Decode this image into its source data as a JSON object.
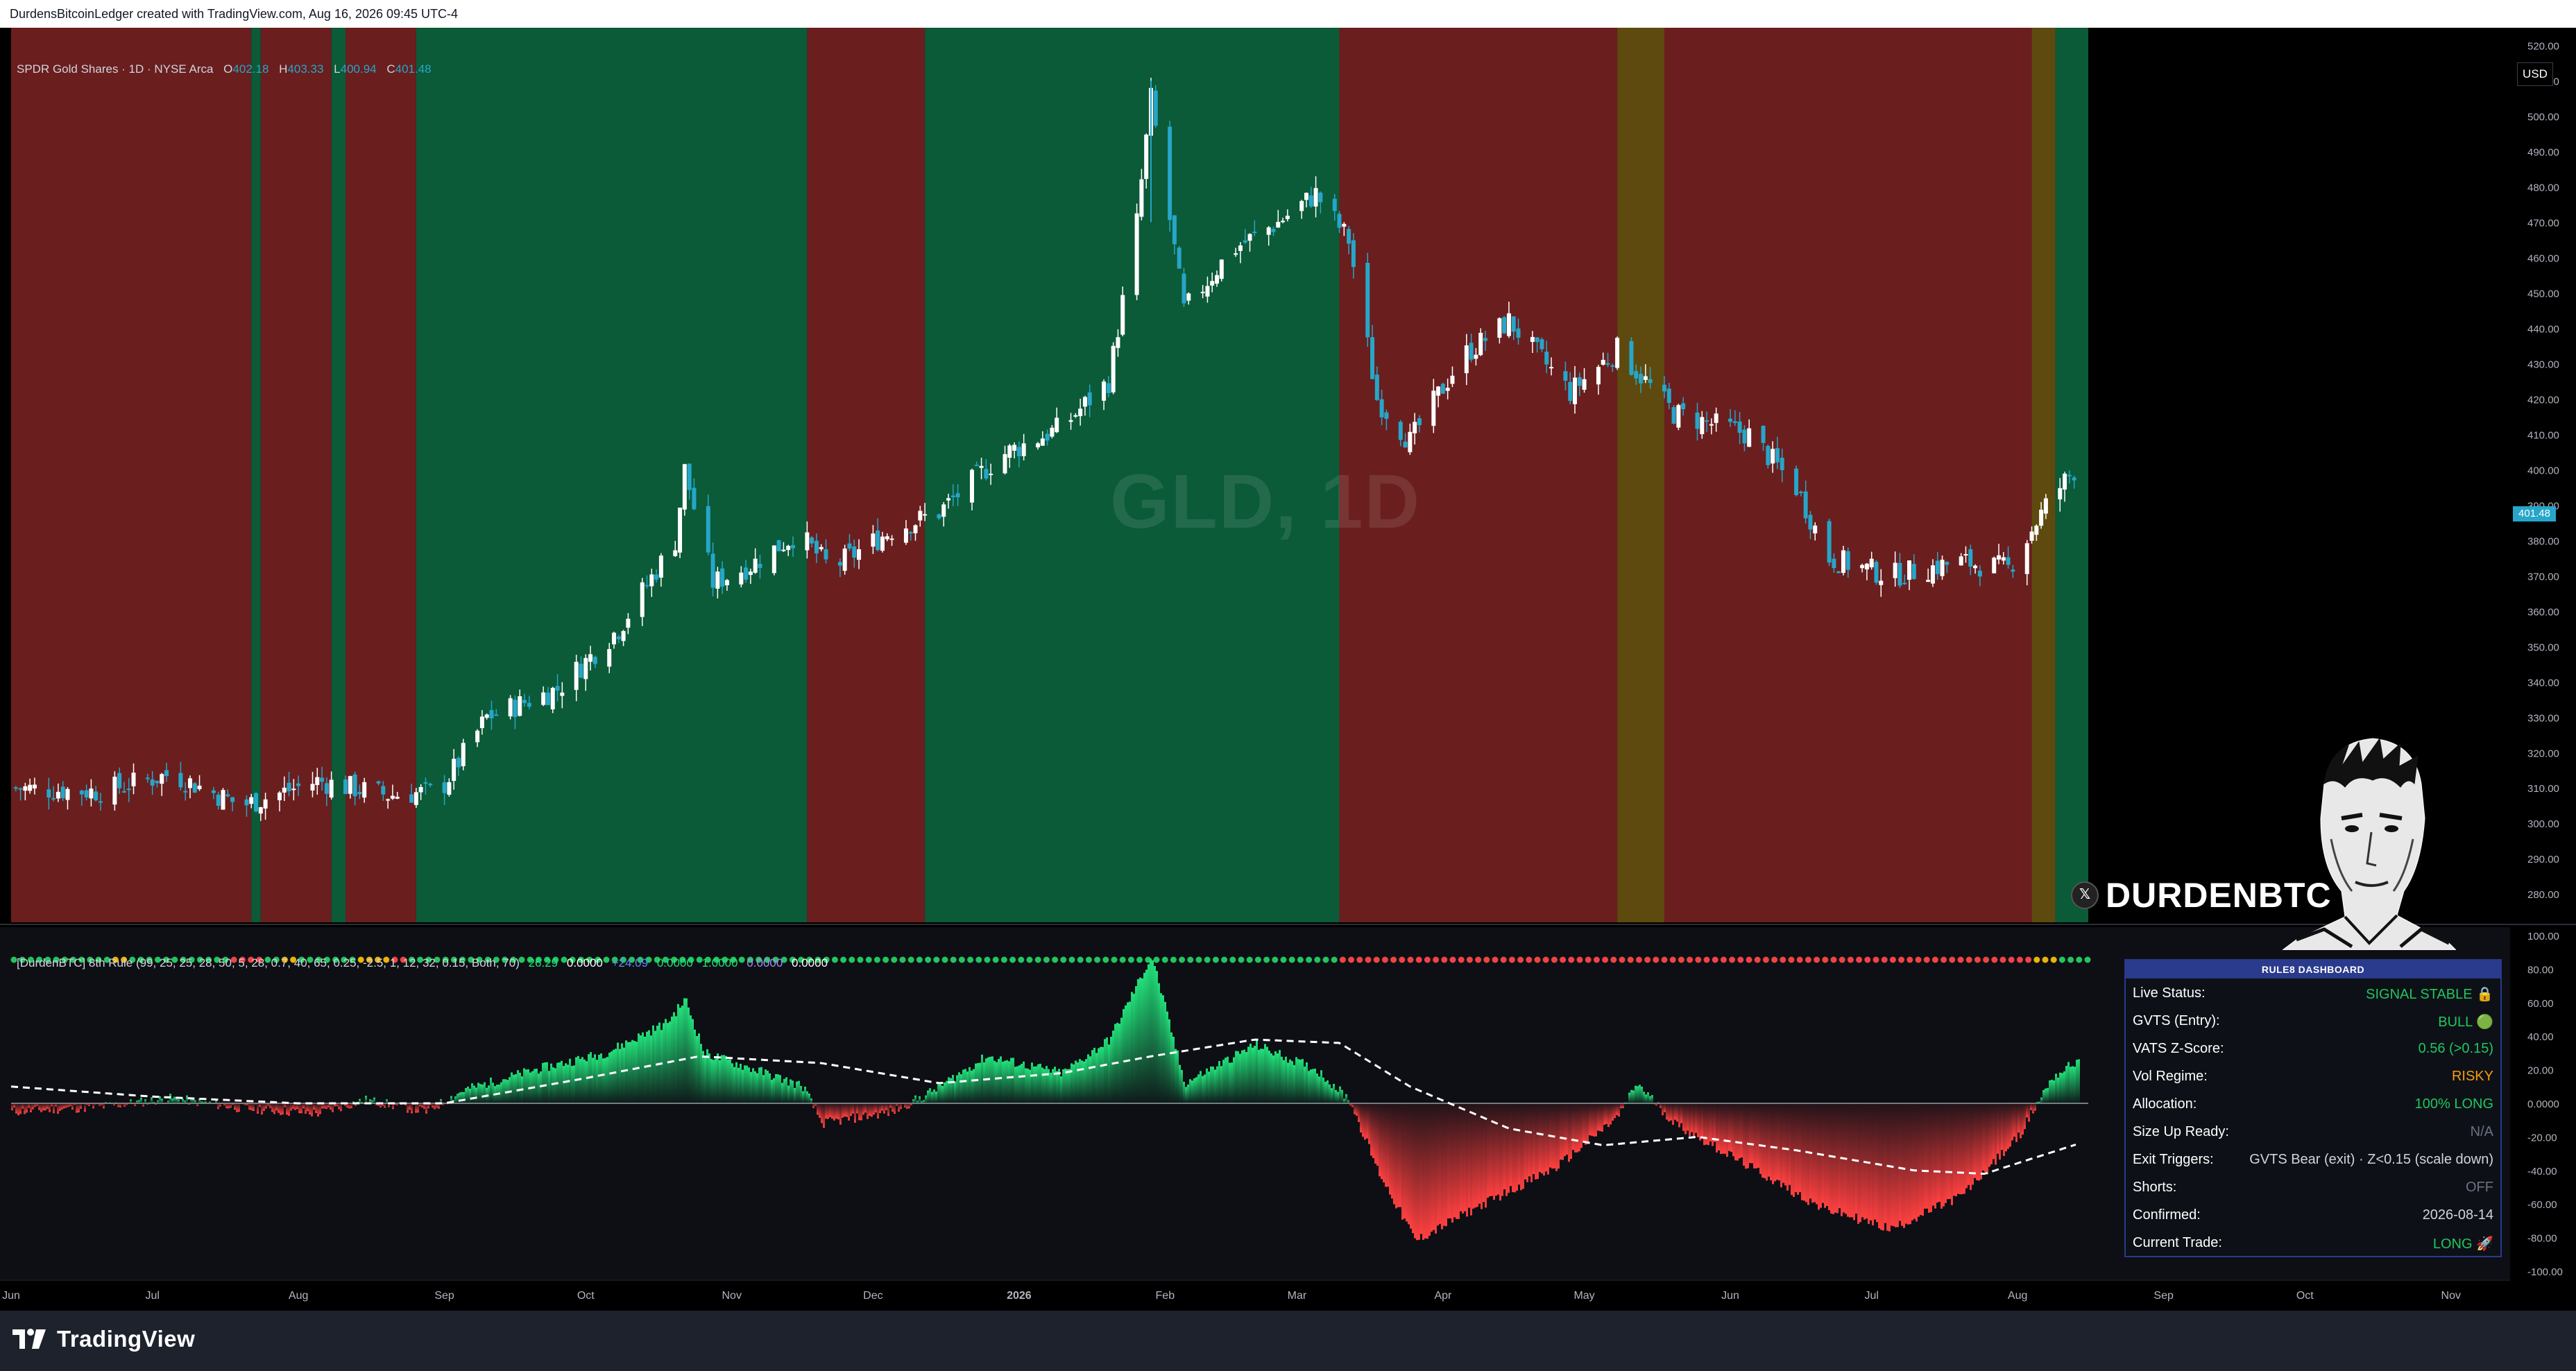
{
  "header": {
    "credit": "DurdensBitcoinLedger created with TradingView.com, Aug 16, 2026 09:45 UTC-4"
  },
  "legend": {
    "symbol": "SPDR Gold Shares · 1D · NYSE Arca",
    "o_label": "O",
    "o": "402.18",
    "h_label": "H",
    "h": "403.33",
    "l_label": "L",
    "l": "400.94",
    "c_label": "C",
    "c": "401.48"
  },
  "watermark": "GLD, 1D",
  "currency": "USD",
  "last_price": "401.48",
  "indicator_legend": {
    "name": "[DurdenBTC] 8th Rule (99, 25, 25, 28, 50, 5, 28, 0.7, 40, 65, 0.25, -2.5, 1, 12, 32, 0.15, Both, 70)",
    "v1": "26.29",
    "v2": "0.0000",
    "v3": "+24.09",
    "v4": "0.0000",
    "v5": "1.0000",
    "v6": "0.0000",
    "v7": "0.0000"
  },
  "dashboard": {
    "title": "RULE8 DASHBOARD",
    "rows": [
      {
        "label": "Live Status:",
        "value": "SIGNAL STABLE 🔒",
        "color": "#22c55e"
      },
      {
        "label": "GVTS (Entry):",
        "value": "BULL 🟢",
        "color": "#22c55e"
      },
      {
        "label": "VATS Z-Score:",
        "value": "0.56 (>0.15)",
        "color": "#22c55e"
      },
      {
        "label": "Vol Regime:",
        "value": "RISKY",
        "color": "#f59e0b"
      },
      {
        "label": "Allocation:",
        "value": "100% LONG",
        "color": "#22c55e"
      },
      {
        "label": "Size Up Ready:",
        "value": "N/A",
        "color": "#6b7280"
      },
      {
        "label": "Exit Triggers:",
        "value": "GVTS Bear (exit) · Z<0.15 (scale down)",
        "color": "#d1d4dc"
      },
      {
        "label": "Shorts:",
        "value": "OFF",
        "color": "#6b7280"
      },
      {
        "label": "Confirmed:",
        "value": "2026-08-14",
        "color": "#d1d4dc"
      },
      {
        "label": "Current Trade:",
        "value": "LONG 🚀",
        "color": "#22c55e"
      }
    ]
  },
  "handle": "DURDENBTC",
  "handle_icon": "x-logo-icon",
  "brand": "TradingView",
  "colors": {
    "bull_bg": "#0b5a38",
    "bear_bg": "#6a1e1e",
    "neutral_bg": "#5e4a0e",
    "up_candle": "#ffffff",
    "down_candle": "#26a6c8",
    "osc_pos": "#22e07a",
    "osc_neg": "#ff4040"
  },
  "chart_data": [
    {
      "type": "candlestick",
      "title": "SPDR Gold Shares · 1D · NYSE Arca",
      "ylim": [
        272,
        525
      ],
      "y_ticks": [
        280,
        290,
        300,
        310,
        320,
        330,
        340,
        350,
        360,
        370,
        380,
        390,
        400,
        410,
        420,
        430,
        440,
        450,
        460,
        470,
        480,
        490,
        500,
        510,
        520
      ],
      "x_tick_labels": [
        "Jun",
        "Jul",
        "Aug",
        "Sep",
        "Oct",
        "Nov",
        "Dec",
        "2026",
        "Feb",
        "Mar",
        "Apr",
        "May",
        "Jun",
        "Jul",
        "Aug",
        "Sep",
        "Oct",
        "Nov"
      ],
      "x_tick_dates": [
        "2025-06-01",
        "2025-07-01",
        "2025-08-01",
        "2025-09-01",
        "2025-10-01",
        "2025-11-01",
        "2025-12-01",
        "2026-01-01",
        "2026-02-01",
        "2026-03-01",
        "2026-04-01",
        "2026-05-01",
        "2026-06-01",
        "2026-07-01",
        "2026-08-01",
        "2026-09-01",
        "2026-10-01",
        "2026-11-01"
      ],
      "close_path": [
        {
          "date": "2025-06-01",
          "close": 310
        },
        {
          "date": "2025-06-20",
          "close": 309
        },
        {
          "date": "2025-07-05",
          "close": 314
        },
        {
          "date": "2025-07-20",
          "close": 305
        },
        {
          "date": "2025-08-05",
          "close": 312
        },
        {
          "date": "2025-08-20",
          "close": 308
        },
        {
          "date": "2025-08-31",
          "close": 309
        },
        {
          "date": "2025-09-10",
          "close": 330
        },
        {
          "date": "2025-09-25",
          "close": 338
        },
        {
          "date": "2025-10-08",
          "close": 355
        },
        {
          "date": "2025-10-20",
          "close": 380
        },
        {
          "date": "2025-10-22",
          "close": 400
        },
        {
          "date": "2025-10-28",
          "close": 368
        },
        {
          "date": "2025-11-05",
          "close": 373
        },
        {
          "date": "2025-11-15",
          "close": 382
        },
        {
          "date": "2025-11-22",
          "close": 372
        },
        {
          "date": "2025-12-05",
          "close": 383
        },
        {
          "date": "2025-12-15",
          "close": 388
        },
        {
          "date": "2025-12-28",
          "close": 404
        },
        {
          "date": "2026-01-10",
          "close": 412
        },
        {
          "date": "2026-01-20",
          "close": 425
        },
        {
          "date": "2026-01-26",
          "close": 470
        },
        {
          "date": "2026-01-29",
          "close": 505
        },
        {
          "date": "2026-02-05",
          "close": 445
        },
        {
          "date": "2026-02-15",
          "close": 462
        },
        {
          "date": "2026-02-25",
          "close": 470
        },
        {
          "date": "2026-03-05",
          "close": 478
        },
        {
          "date": "2026-03-12",
          "close": 465
        },
        {
          "date": "2026-03-18",
          "close": 420
        },
        {
          "date": "2026-03-25",
          "close": 408
        },
        {
          "date": "2026-04-05",
          "close": 432
        },
        {
          "date": "2026-04-15",
          "close": 442
        },
        {
          "date": "2026-04-28",
          "close": 422
        },
        {
          "date": "2026-05-08",
          "close": 434
        },
        {
          "date": "2026-05-20",
          "close": 416
        },
        {
          "date": "2026-06-05",
          "close": 410
        },
        {
          "date": "2026-06-15",
          "close": 395
        },
        {
          "date": "2026-06-22",
          "close": 375
        },
        {
          "date": "2026-07-05",
          "close": 370
        },
        {
          "date": "2026-07-20",
          "close": 374
        },
        {
          "date": "2026-07-30",
          "close": 372
        },
        {
          "date": "2026-08-08",
          "close": 392
        },
        {
          "date": "2026-08-14",
          "close": 401.48
        }
      ],
      "regimes": [
        {
          "from": "2025-06-01",
          "to": "2025-07-22",
          "state": "bear"
        },
        {
          "from": "2025-07-22",
          "to": "2025-07-24",
          "state": "bull"
        },
        {
          "from": "2025-07-24",
          "to": "2025-08-08",
          "state": "bear"
        },
        {
          "from": "2025-08-08",
          "to": "2025-08-11",
          "state": "bull"
        },
        {
          "from": "2025-08-11",
          "to": "2025-08-26",
          "state": "bear"
        },
        {
          "from": "2025-08-26",
          "to": "2025-11-17",
          "state": "bull"
        },
        {
          "from": "2025-11-17",
          "to": "2025-12-12",
          "state": "bear"
        },
        {
          "from": "2025-12-12",
          "to": "2026-03-10",
          "state": "bull"
        },
        {
          "from": "2026-03-10",
          "to": "2026-05-08",
          "state": "bear"
        },
        {
          "from": "2026-05-08",
          "to": "2026-05-18",
          "state": "neutral"
        },
        {
          "from": "2026-05-18",
          "to": "2026-08-04",
          "state": "bear"
        },
        {
          "from": "2026-08-04",
          "to": "2026-08-09",
          "state": "neutral"
        },
        {
          "from": "2026-08-09",
          "to": "2026-08-16",
          "state": "bull"
        }
      ]
    },
    {
      "type": "area",
      "title": "[DurdenBTC] 8th Rule",
      "ylim": [
        -105,
        105
      ],
      "y_ticks": [
        100,
        80,
        60,
        40,
        20,
        0,
        -20,
        -40,
        -60,
        -80,
        -100
      ],
      "y_tick_labels": [
        "100.00",
        "80.00",
        "60.00",
        "40.00",
        "20.00",
        "0.0000",
        "-20.00",
        "-40.00",
        "-60.00",
        "-80.00",
        "-100.00"
      ],
      "series": [
        {
          "values": [
            {
              "date": "2025-06-01",
              "v": -5
            },
            {
              "date": "2025-06-20",
              "v": -2
            },
            {
              "date": "2025-07-05",
              "v": 3
            },
            {
              "date": "2025-07-20",
              "v": -3
            },
            {
              "date": "2025-08-05",
              "v": -6
            },
            {
              "date": "2025-08-15",
              "v": 2
            },
            {
              "date": "2025-08-28",
              "v": -5
            },
            {
              "date": "2025-09-05",
              "v": 8
            },
            {
              "date": "2025-09-20",
              "v": 20
            },
            {
              "date": "2025-10-05",
              "v": 30
            },
            {
              "date": "2025-10-18",
              "v": 48
            },
            {
              "date": "2025-10-22",
              "v": 62
            },
            {
              "date": "2025-10-26",
              "v": 30
            },
            {
              "date": "2025-11-08",
              "v": 18
            },
            {
              "date": "2025-11-16",
              "v": 10
            },
            {
              "date": "2025-11-20",
              "v": -12
            },
            {
              "date": "2025-12-05",
              "v": -5
            },
            {
              "date": "2025-12-12",
              "v": 5
            },
            {
              "date": "2025-12-25",
              "v": 28
            },
            {
              "date": "2026-01-10",
              "v": 18
            },
            {
              "date": "2026-01-20",
              "v": 38
            },
            {
              "date": "2026-01-29",
              "v": 88
            },
            {
              "date": "2026-02-05",
              "v": 12
            },
            {
              "date": "2026-02-20",
              "v": 35
            },
            {
              "date": "2026-03-05",
              "v": 20
            },
            {
              "date": "2026-03-12",
              "v": 2
            },
            {
              "date": "2026-03-18",
              "v": -40
            },
            {
              "date": "2026-03-26",
              "v": -82
            },
            {
              "date": "2026-04-08",
              "v": -62
            },
            {
              "date": "2026-04-25",
              "v": -38
            },
            {
              "date": "2026-05-08",
              "v": -8
            },
            {
              "date": "2026-05-12",
              "v": 12
            },
            {
              "date": "2026-05-20",
              "v": -12
            },
            {
              "date": "2026-06-05",
              "v": -38
            },
            {
              "date": "2026-06-20",
              "v": -62
            },
            {
              "date": "2026-07-05",
              "v": -75
            },
            {
              "date": "2026-07-20",
              "v": -55
            },
            {
              "date": "2026-08-01",
              "v": -20
            },
            {
              "date": "2026-08-08",
              "v": 15
            },
            {
              "date": "2026-08-14",
              "v": 26.29
            }
          ]
        },
        {
          "values": [
            {
              "date": "2025-06-01",
              "v": 10
            },
            {
              "date": "2025-07-01",
              "v": 4
            },
            {
              "date": "2025-08-01",
              "v": 0
            },
            {
              "date": "2025-09-01",
              "v": 0
            },
            {
              "date": "2025-10-01",
              "v": 15
            },
            {
              "date": "2025-10-25",
              "v": 28
            },
            {
              "date": "2025-11-20",
              "v": 24
            },
            {
              "date": "2025-12-15",
              "v": 12
            },
            {
              "date": "2026-01-10",
              "v": 18
            },
            {
              "date": "2026-01-29",
              "v": 28
            },
            {
              "date": "2026-02-20",
              "v": 38
            },
            {
              "date": "2026-03-10",
              "v": 36
            },
            {
              "date": "2026-03-25",
              "v": 10
            },
            {
              "date": "2026-04-15",
              "v": -15
            },
            {
              "date": "2026-05-05",
              "v": -25
            },
            {
              "date": "2026-05-25",
              "v": -20
            },
            {
              "date": "2026-06-15",
              "v": -28
            },
            {
              "date": "2026-07-10",
              "v": -40
            },
            {
              "date": "2026-07-25",
              "v": -42
            },
            {
              "date": "2026-08-14",
              "v": -24
            }
          ]
        }
      ]
    }
  ]
}
